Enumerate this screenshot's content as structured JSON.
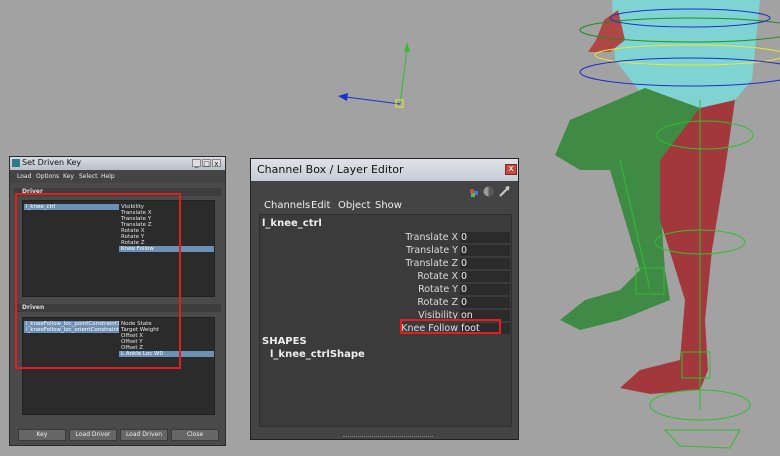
{
  "set_driven_key": {
    "title": "Set Driven Key",
    "menu": [
      "Load",
      "Options",
      "Key",
      "Select",
      "Help"
    ],
    "driver_section": "Driver",
    "driver_objects": [
      "l_knee_ctrl"
    ],
    "driver_attributes": [
      "Visibility",
      "Translate X",
      "Translate Y",
      "Translate Z",
      "Rotate X",
      "Rotate Y",
      "Rotate Z",
      "Knee Follow"
    ],
    "driver_selected_attribute": "Knee Follow",
    "driven_section": "Driven",
    "driven_objects": [
      "l_kneeFollow_loc_pointConstraint1",
      "l_kneeFollow_loc_orientConstraint1"
    ],
    "driven_attributes": [
      "Node State",
      "Target Weight",
      "Offset X",
      "Offset Y",
      "Offset Z",
      "L Ankle Loc W0"
    ],
    "driven_selected_attribute": "L Ankle Loc W0",
    "buttons": {
      "key": "Key",
      "load_driver": "Load Driver",
      "load_driven": "Load Driven",
      "close": "Close"
    }
  },
  "channel_box": {
    "title": "Channel Box / Layer Editor",
    "close_glyph": "x",
    "menu": {
      "channels": "Channels",
      "edit": "Edit",
      "object": "Object",
      "show": "Show"
    },
    "node_name": "l_knee_ctrl",
    "channels": [
      {
        "label": "Translate X",
        "value": "0"
      },
      {
        "label": "Translate Y",
        "value": "0"
      },
      {
        "label": "Translate Z",
        "value": "0"
      },
      {
        "label": "Rotate X",
        "value": "0"
      },
      {
        "label": "Rotate Y",
        "value": "0"
      },
      {
        "label": "Rotate Z",
        "value": "0"
      },
      {
        "label": "Visibility",
        "value": "on"
      },
      {
        "label": "Knee Follow",
        "value": "foot"
      }
    ],
    "shapes_header": "SHAPES",
    "shape_name": "l_knee_ctrlShape"
  },
  "colors": {
    "highlight_red": "#e0201e",
    "selection_blue": "#6f90b5",
    "leg_green": "#3f8a45",
    "leg_red": "#a2383b",
    "torso_cyan": "#7fd3d3"
  }
}
